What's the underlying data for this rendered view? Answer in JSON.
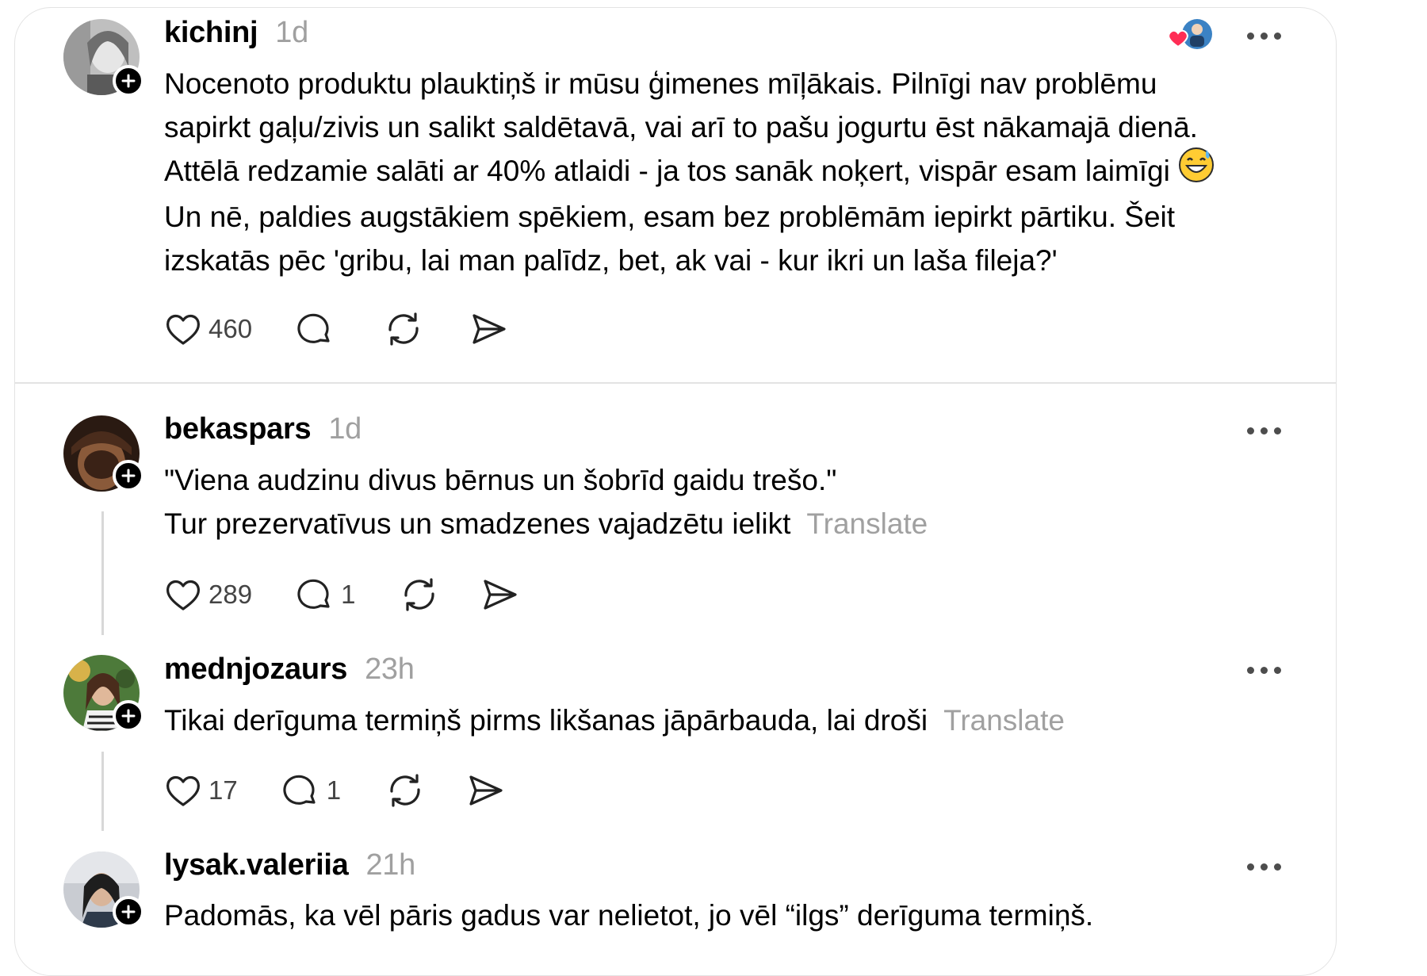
{
  "posts": [
    {
      "username": "kichinj",
      "time": "1d",
      "lines": [
        "Nocenoto produktu plauktiņš ir mūsu ģimenes mīļākais. Pilnīgi nav problēmu",
        "sapirkt gaļu/zivis un salikt saldētavā, vai arī to pašu jogurtu ēst nākamajā dienā.",
        "Attēlā redzamie salāti ar 40% atlaidi - ja tos sanāk noķert, vispār esam laimīgi",
        "Un nē, paldies augstākiem spēkiem, esam bez problēmām iepirkt pārtiku. Šeit",
        "izskatās pēc 'gribu, lai man palīdz, bet, ak vai - kur ikri un laša fileja?'"
      ],
      "likes": "460"
    },
    {
      "username": "bekaspars",
      "time": "1d",
      "lines": [
        "\"Viena audzinu divus bērnus un šobrīd gaidu trešo.\"",
        "Tur prezervatīvus un smadzenes vajadzētu ielikt"
      ],
      "translate": "Translate",
      "likes": "289",
      "replies": "1"
    },
    {
      "username": "mednjozaurs",
      "time": "23h",
      "lines": [
        "Tikai derīguma termiņš pirms likšanas jāpārbauda, lai droši"
      ],
      "translate": "Translate",
      "likes": "17",
      "replies": "1"
    },
    {
      "username": "lysak.valeriia",
      "time": "21h",
      "lines": [
        "Padomās, ka vēl pāris gadus var nelietot, jo vēl “ilgs” derīguma termiņš."
      ]
    }
  ],
  "icons": {
    "like": "heart-icon",
    "reply": "comment-icon",
    "repost": "repost-icon",
    "share": "share-icon",
    "more": "more-options-icon",
    "follow": "plus-icon",
    "emoji": "grinning-sweat-emoji"
  },
  "colors": {
    "muted_text": "#a0a0a0",
    "liked_heart": "#ff2d55",
    "border": "#e3e3e3"
  }
}
